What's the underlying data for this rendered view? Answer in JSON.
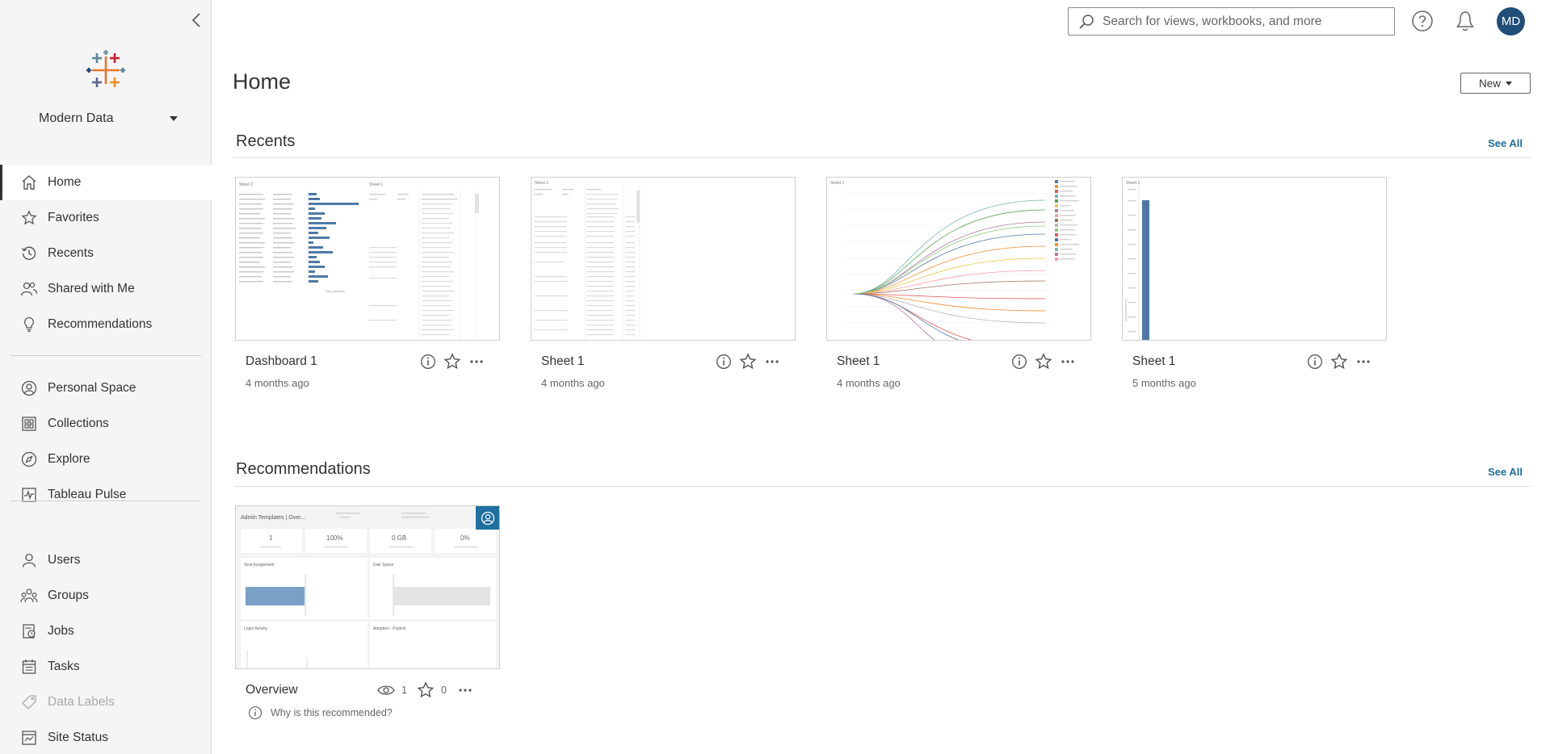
{
  "sidebar": {
    "site_name": "Modern Data",
    "items": [
      {
        "label": "Home",
        "icon": "home-icon",
        "active": true
      },
      {
        "label": "Favorites",
        "icon": "star-icon"
      },
      {
        "label": "Recents",
        "icon": "history-icon"
      },
      {
        "label": "Shared with Me",
        "icon": "shared-users-icon"
      },
      {
        "label": "Recommendations",
        "icon": "lightbulb-icon"
      },
      {
        "label": "Personal Space",
        "icon": "person-circle-icon"
      },
      {
        "label": "Collections",
        "icon": "collections-icon"
      },
      {
        "label": "Explore",
        "icon": "explore-icon"
      },
      {
        "label": "Tableau Pulse",
        "icon": "pulse-icon"
      },
      {
        "label": "Users",
        "icon": "user-icon"
      },
      {
        "label": "Groups",
        "icon": "group-icon"
      },
      {
        "label": "Jobs",
        "icon": "jobs-icon"
      },
      {
        "label": "Tasks",
        "icon": "tasks-icon"
      },
      {
        "label": "Data Labels",
        "icon": "tag-icon",
        "disabled": true
      },
      {
        "label": "Site Status",
        "icon": "site-status-icon"
      }
    ]
  },
  "header": {
    "search_placeholder": "Search for views, workbooks, and more",
    "avatar_initials": "MD"
  },
  "main": {
    "title": "Home",
    "new_button": "New",
    "recents": {
      "title": "Recents",
      "see_all": "See All",
      "cards": [
        {
          "name": "Dashboard 1",
          "time": "4 months ago"
        },
        {
          "name": "Sheet 1",
          "time": "4 months ago"
        },
        {
          "name": "Sheet 1",
          "time": "4 months ago"
        },
        {
          "name": "Sheet 1",
          "time": "5 months ago"
        }
      ]
    },
    "recommendations": {
      "title": "Recommendations",
      "see_all": "See All",
      "cards": [
        {
          "name": "Overview",
          "views": "1",
          "favorites": "0",
          "why": "Why is this recommended?"
        }
      ]
    }
  },
  "colors": {
    "accent": "#1f6f9f",
    "avatar": "#1f4e79",
    "chart_bar": "#4e79a7"
  }
}
